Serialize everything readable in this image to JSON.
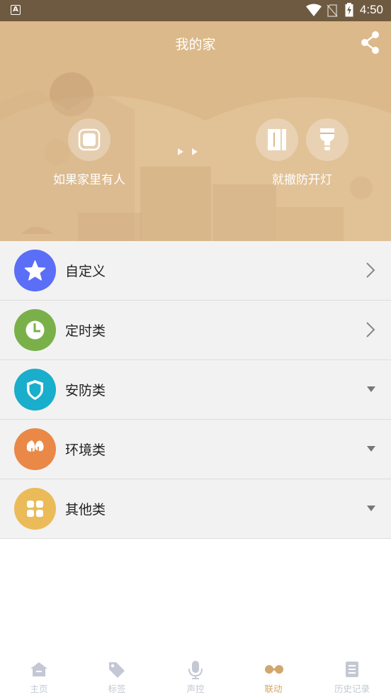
{
  "status_bar": {
    "time": "4:50",
    "app_badge": "A"
  },
  "header": {
    "title": "我的家",
    "share_icon": "share-icon"
  },
  "scene": {
    "condition_label": "如果家里有人",
    "action_label": "就撤防开灯",
    "condition_icon": "presence-sensor-icon",
    "action_icons": [
      "door-sensor-icon",
      "light-bulb-icon"
    ]
  },
  "categories": [
    {
      "label": "自定义",
      "icon": "star-icon",
      "color": "#5a6ef7",
      "indicator": "chevron-right"
    },
    {
      "label": "定时类",
      "icon": "clock-icon",
      "color": "#7ab04a",
      "indicator": "chevron-right"
    },
    {
      "label": "安防类",
      "icon": "shield-icon",
      "color": "#19aecb",
      "indicator": "triangle-down"
    },
    {
      "label": "环境类",
      "icon": "leaf-icon",
      "color": "#ea8847",
      "indicator": "triangle-down"
    },
    {
      "label": "其他类",
      "icon": "grid-icon",
      "color": "#ebbb5a",
      "indicator": "triangle-down"
    }
  ],
  "tabs": [
    {
      "label": "主页",
      "icon": "home-icon",
      "active": false
    },
    {
      "label": "标签",
      "icon": "tag-icon",
      "active": false
    },
    {
      "label": "声控",
      "icon": "microphone-icon",
      "active": false
    },
    {
      "label": "联动",
      "icon": "link-icon",
      "active": true
    },
    {
      "label": "历史记录",
      "icon": "history-icon",
      "active": false
    }
  ],
  "colors": {
    "hero": "#dcb98a",
    "status_bar": "#6e5a40",
    "active_tab": "#d1a76e",
    "inactive_tab": "#c4c8d4"
  }
}
